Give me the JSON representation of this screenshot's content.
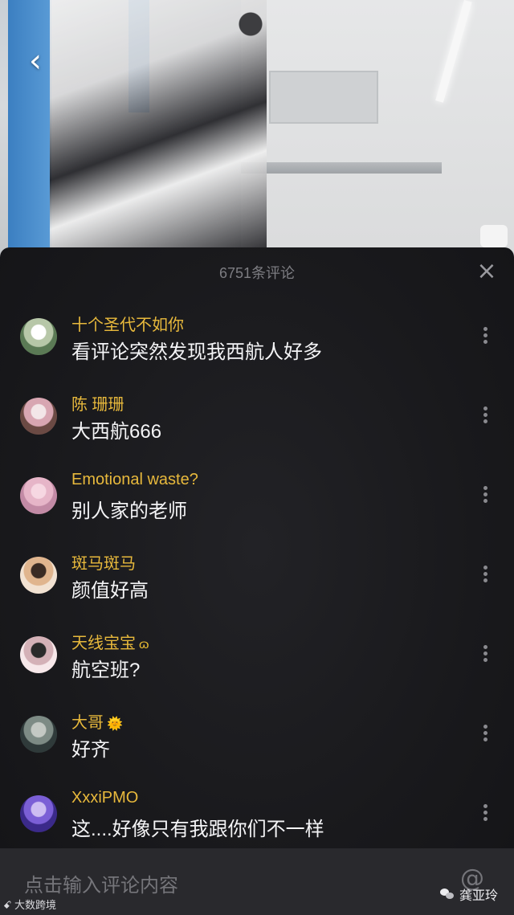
{
  "header": {
    "back_icon": "chevron-left-icon",
    "back_glyph": "‹"
  },
  "comments_panel": {
    "title": "6751条评论",
    "close_glyph": "×",
    "comments": [
      {
        "username": "十个圣代不如你",
        "text": "看评论突然发现我西航人好多",
        "badge": "",
        "avatar_colors": [
          "#5b7a55",
          "#b7c7a8",
          "#ffffff"
        ]
      },
      {
        "username": "陈 珊珊",
        "text": "大西航666",
        "badge": "",
        "avatar_colors": [
          "#6b4a44",
          "#d8a6b2",
          "#f3e6e8"
        ]
      },
      {
        "username": "Emotional waste?",
        "text": "别人家的老师",
        "badge": "",
        "avatar_colors": [
          "#c28aa5",
          "#e6b5c8",
          "#f6d7e2"
        ]
      },
      {
        "username": "斑马斑马",
        "text": "颜值好高",
        "badge": "",
        "avatar_colors": [
          "#f2e2d2",
          "#e0b58e",
          "#3a2b23"
        ]
      },
      {
        "username": "天线宝宝",
        "text": "航空班?",
        "badge": "ɷ",
        "avatar_colors": [
          "#f7e8ea",
          "#d4b1b7",
          "#2a2a2a"
        ]
      },
      {
        "username": "大哥",
        "text": "好齐",
        "badge": "🌞",
        "avatar_colors": [
          "#2f3a3a",
          "#7d8b85",
          "#c4c9c4"
        ]
      },
      {
        "username": "XxxiPMO",
        "text": "这....好像只有我跟你们不一样",
        "badge": "",
        "avatar_colors": [
          "#3b2a8a",
          "#7b5fd6",
          "#cdbdf2"
        ]
      }
    ],
    "more_icon": "more-vertical-icon"
  },
  "input": {
    "placeholder": "点击输入评论内容",
    "at_glyph": "@"
  },
  "watermarks": {
    "left": "大数跨境",
    "left_prefix": "ꗃ",
    "right": "龚亚玲"
  }
}
